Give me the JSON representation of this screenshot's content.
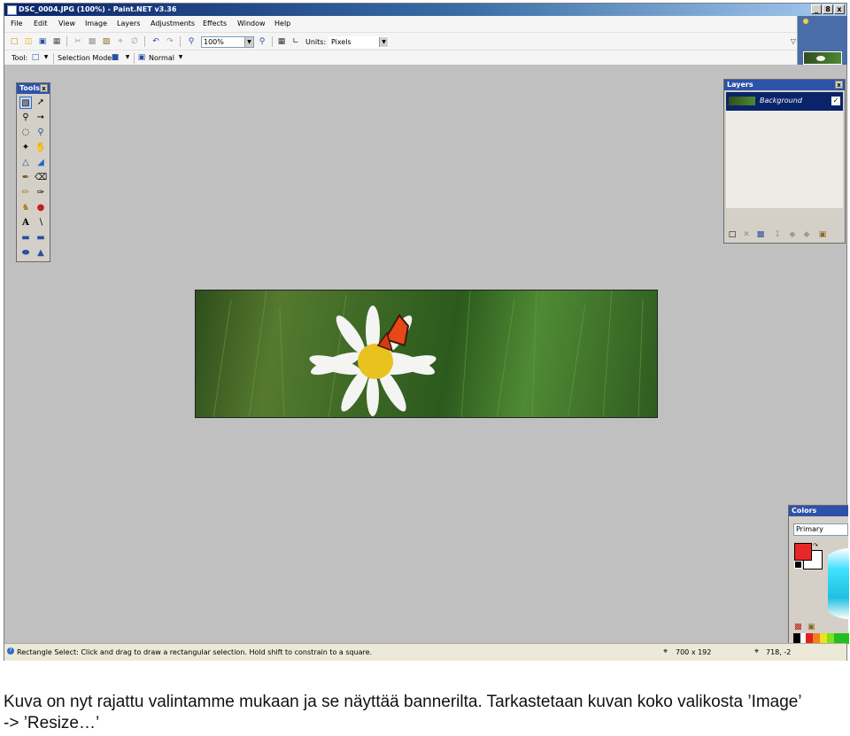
{
  "window": {
    "title": "DSC_0004.JPG (100%) - Paint.NET v3.36",
    "buttons": {
      "minimize": "_",
      "restore": "8",
      "close": "x"
    }
  },
  "menu": [
    "File",
    "Edit",
    "View",
    "Image",
    "Layers",
    "Adjustments",
    "Effects",
    "Window",
    "Help"
  ],
  "toolbar": {
    "zoom_value": "100%",
    "units_label": "Units:",
    "units_value": "Pixels"
  },
  "toolbar2": {
    "tool_label": "Tool:",
    "selection_mode_label": "Selection Mode:",
    "blend_mode": "Normal"
  },
  "tools_panel": {
    "title": "Tools",
    "close": "x"
  },
  "layers_panel": {
    "title": "Layers",
    "close": "x",
    "layers": [
      {
        "name": "Background",
        "visible": true
      }
    ]
  },
  "colors_panel": {
    "title": "Colors",
    "mode_value": "Primary",
    "primary_color": "#e82828",
    "secondary_color": "#ffffff"
  },
  "status": {
    "hint": "Rectangle Select: Click and drag to draw a rectangular selection. Hold shift to constrain to a square.",
    "image_size": "700 x 192",
    "cursor_pos": "718, -2"
  },
  "caption": {
    "line1": "Kuva on nyt rajattu valintamme mukaan ja se näyttää bannerilta. Tarkastetaan kuvan koko valikosta ’Image’",
    "line2": "-> ’Resize…’"
  },
  "colors": {
    "title_bar": "#0a246a",
    "panel_title": "#2d52a8",
    "workspace": "#c0c0c0"
  }
}
